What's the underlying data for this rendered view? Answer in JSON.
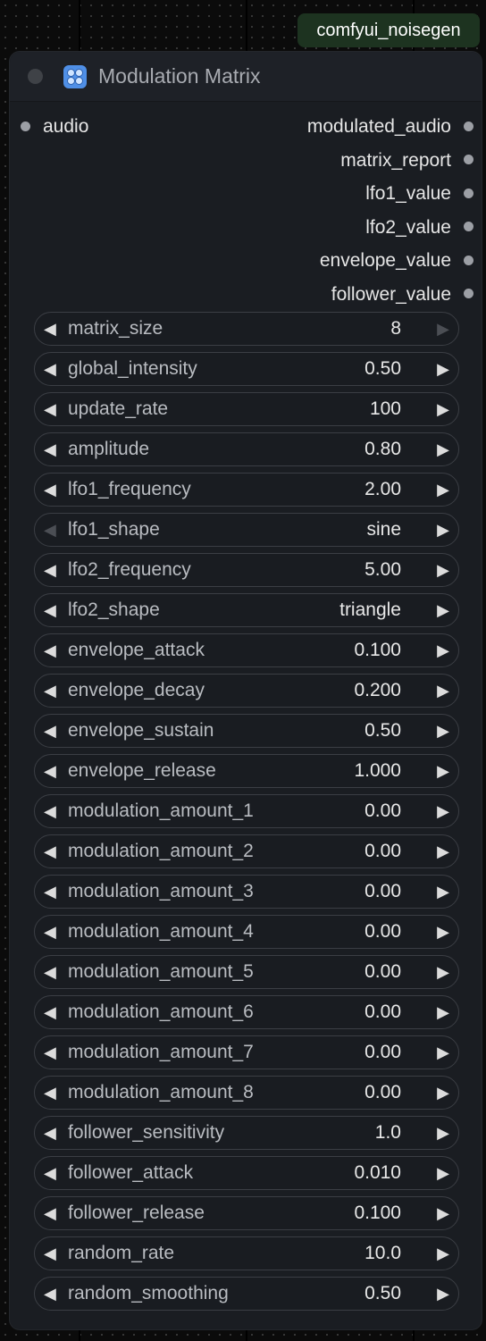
{
  "badge": {
    "label": "comfyui_noisegen"
  },
  "node": {
    "title": "Modulation Matrix",
    "icon": "matrix-grid-icon",
    "inputs": [
      {
        "label": "audio"
      }
    ],
    "outputs": [
      {
        "label": "modulated_audio"
      },
      {
        "label": "matrix_report"
      },
      {
        "label": "lfo1_value"
      },
      {
        "label": "lfo2_value"
      },
      {
        "label": "envelope_value"
      },
      {
        "label": "follower_value"
      }
    ],
    "widgets": [
      {
        "name": "matrix_size",
        "value": "8",
        "left_enabled": true,
        "right_enabled": false
      },
      {
        "name": "global_intensity",
        "value": "0.50",
        "left_enabled": true,
        "right_enabled": true
      },
      {
        "name": "update_rate",
        "value": "100",
        "left_enabled": true,
        "right_enabled": true
      },
      {
        "name": "amplitude",
        "value": "0.80",
        "left_enabled": true,
        "right_enabled": true
      },
      {
        "name": "lfo1_frequency",
        "value": "2.00",
        "left_enabled": true,
        "right_enabled": true
      },
      {
        "name": "lfo1_shape",
        "value": "sine",
        "left_enabled": false,
        "right_enabled": true
      },
      {
        "name": "lfo2_frequency",
        "value": "5.00",
        "left_enabled": true,
        "right_enabled": true
      },
      {
        "name": "lfo2_shape",
        "value": "triangle",
        "left_enabled": true,
        "right_enabled": true
      },
      {
        "name": "envelope_attack",
        "value": "0.100",
        "left_enabled": true,
        "right_enabled": true
      },
      {
        "name": "envelope_decay",
        "value": "0.200",
        "left_enabled": true,
        "right_enabled": true
      },
      {
        "name": "envelope_sustain",
        "value": "0.50",
        "left_enabled": true,
        "right_enabled": true
      },
      {
        "name": "envelope_release",
        "value": "1.000",
        "left_enabled": true,
        "right_enabled": true
      },
      {
        "name": "modulation_amount_1",
        "value": "0.00",
        "left_enabled": true,
        "right_enabled": true
      },
      {
        "name": "modulation_amount_2",
        "value": "0.00",
        "left_enabled": true,
        "right_enabled": true
      },
      {
        "name": "modulation_amount_3",
        "value": "0.00",
        "left_enabled": true,
        "right_enabled": true
      },
      {
        "name": "modulation_amount_4",
        "value": "0.00",
        "left_enabled": true,
        "right_enabled": true
      },
      {
        "name": "modulation_amount_5",
        "value": "0.00",
        "left_enabled": true,
        "right_enabled": true
      },
      {
        "name": "modulation_amount_6",
        "value": "0.00",
        "left_enabled": true,
        "right_enabled": true
      },
      {
        "name": "modulation_amount_7",
        "value": "0.00",
        "left_enabled": true,
        "right_enabled": true
      },
      {
        "name": "modulation_amount_8",
        "value": "0.00",
        "left_enabled": true,
        "right_enabled": true
      },
      {
        "name": "follower_sensitivity",
        "value": "1.0",
        "left_enabled": true,
        "right_enabled": true
      },
      {
        "name": "follower_attack",
        "value": "0.010",
        "left_enabled": true,
        "right_enabled": true
      },
      {
        "name": "follower_release",
        "value": "0.100",
        "left_enabled": true,
        "right_enabled": true
      },
      {
        "name": "random_rate",
        "value": "10.0",
        "left_enabled": true,
        "right_enabled": true
      },
      {
        "name": "random_smoothing",
        "value": "0.50",
        "left_enabled": true,
        "right_enabled": true
      }
    ]
  },
  "colors": {
    "node_background": "#1a1d22",
    "badge_background": "#1d3320",
    "slot_dot": "#9c9fa5",
    "icon_accent": "#4f8fe6"
  }
}
